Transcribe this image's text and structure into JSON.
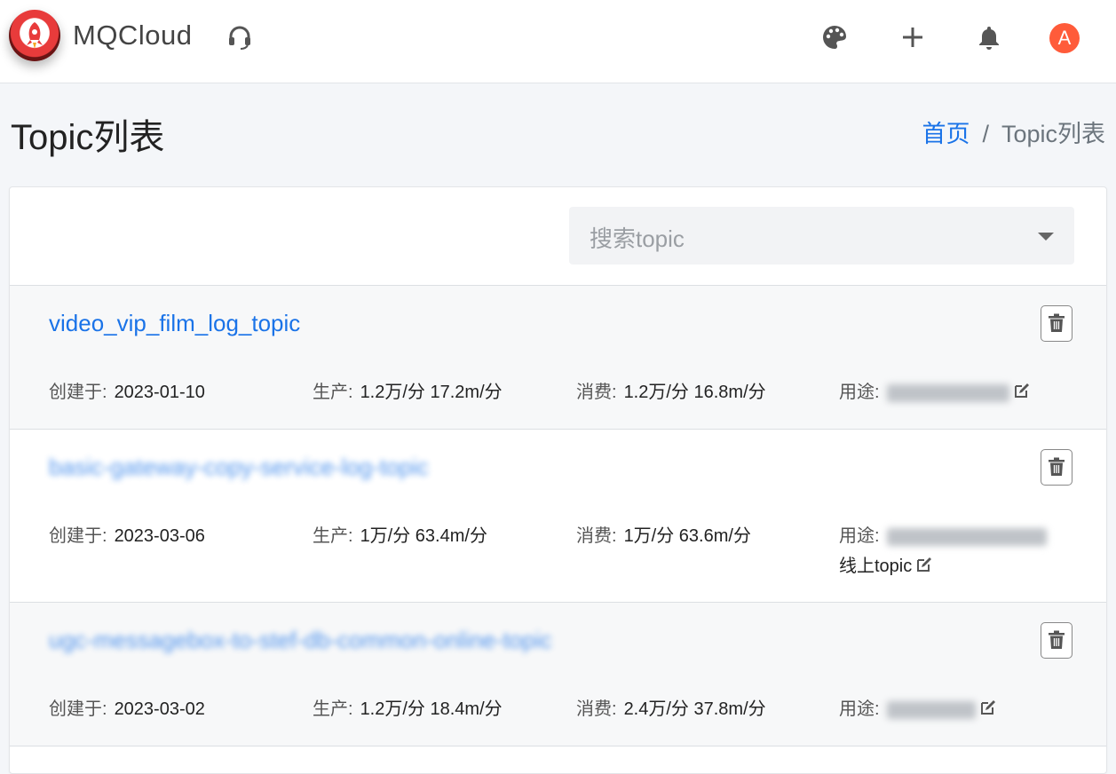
{
  "app": {
    "brand": "MQCloud",
    "avatar_letter": "A",
    "accent": "#1a73e8",
    "avatar_color": "#ff5b3a"
  },
  "nav": {
    "icons": [
      "headset-icon",
      "palette-icon",
      "plus-icon",
      "bell-icon"
    ]
  },
  "page": {
    "title": "Topic列表"
  },
  "breadcrumb": {
    "home": "首页",
    "separator": "/",
    "current": "Topic列表"
  },
  "search": {
    "placeholder": "搜索topic"
  },
  "labels": {
    "created": "创建于:",
    "produce": "生产:",
    "consume": "消费:",
    "usage": "用途:"
  },
  "topics": [
    {
      "name": "video_vip_film_log_topic",
      "created": "2023-01-10",
      "produce": "1.2万/分 17.2m/分",
      "consume": "1.2万/分 16.8m/分",
      "usage_extra": ""
    },
    {
      "name": "basic-gateway-copy-service-log-topic",
      "created": "2023-03-06",
      "produce": "1万/分 63.4m/分",
      "consume": "1万/分 63.6m/分",
      "usage_extra": "线上topic"
    },
    {
      "name": "ugc-messagebox-to-stef-db-common-online-topic",
      "created": "2023-03-02",
      "produce": "1.2万/分 18.4m/分",
      "consume": "2.4万/分 37.8m/分",
      "usage_extra": ""
    }
  ]
}
